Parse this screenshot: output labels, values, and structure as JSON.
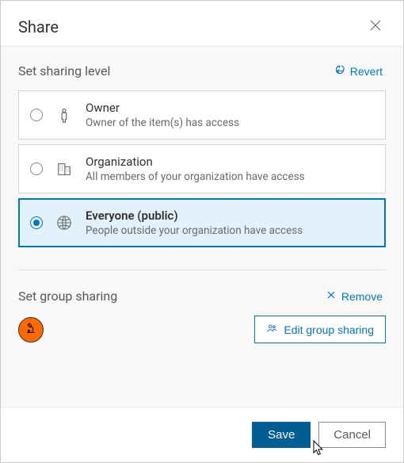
{
  "dialog": {
    "title": "Share"
  },
  "sharingLevel": {
    "label": "Set sharing level",
    "revert": "Revert",
    "options": [
      {
        "title": "Owner",
        "sub": "Owner of the item(s) has access"
      },
      {
        "title": "Organization",
        "sub": "All members of your organization have access"
      },
      {
        "title": "Everyone (public)",
        "sub": "People outside your organization have access"
      }
    ]
  },
  "groupSharing": {
    "label": "Set group sharing",
    "remove": "Remove",
    "edit": "Edit group sharing"
  },
  "footer": {
    "save": "Save",
    "cancel": "Cancel"
  }
}
